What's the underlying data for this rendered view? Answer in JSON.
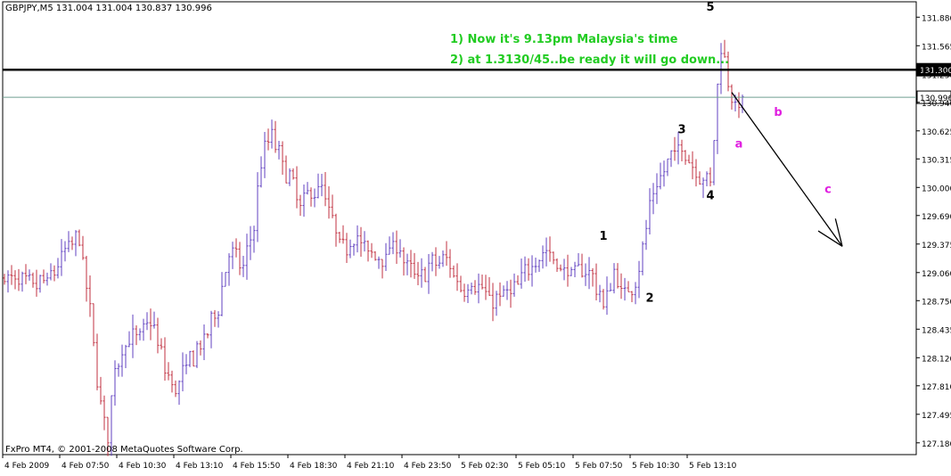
{
  "chart_data": {
    "type": "ohlc",
    "symbol_header": "GBPJPY,M5  131.004 131.004 130.837 130.996",
    "footer": "FxPro MT4, © 2001-2008 MetaQuotes Software Corp.",
    "y_axis": {
      "ylim": [
        127.05,
        132.05
      ],
      "ticks": [
        "131.880",
        "131.565",
        "131.250",
        "130.940",
        "130.625",
        "130.315",
        "130.000",
        "129.690",
        "129.375",
        "129.060",
        "128.750",
        "128.435",
        "128.120",
        "127.810",
        "127.495",
        "127.180"
      ]
    },
    "x_axis": {
      "tick_labels": [
        "4 Feb 2009",
        "4 Feb 07:50",
        "4 Feb 10:30",
        "4 Feb 13:10",
        "4 Feb 15:50",
        "4 Feb 18:30",
        "4 Feb 21:10",
        "4 Feb 23:50",
        "5 Feb 02:30",
        "5 Feb 05:10",
        "5 Feb 07:50",
        "5 Feb 10:30",
        "5 Feb 13:10"
      ]
    },
    "levels": [
      {
        "label": "131.300",
        "value": 131.3,
        "color": "#000000",
        "style": "thick"
      },
      {
        "label": "130.996",
        "value": 130.996,
        "color": "#6f9f90",
        "style": "thin"
      }
    ],
    "annotations": [
      {
        "text": "1) Now it's 9.13pm Malaysia's time",
        "color": "#22cc22"
      },
      {
        "text": "2) at 1.3130/45..be ready it will go down...",
        "color": "#22cc22"
      }
    ],
    "wave_labels": [
      {
        "text": "1",
        "color": "#000000",
        "bar": 168,
        "price": 129.42
      },
      {
        "text": "2",
        "color": "#000000",
        "bar": 181,
        "price": 128.74
      },
      {
        "text": "3",
        "color": "#000000",
        "bar": 190,
        "price": 130.6
      },
      {
        "text": "4",
        "color": "#000000",
        "bar": 198,
        "price": 129.87
      },
      {
        "text": "5",
        "color": "#000000",
        "bar": 198,
        "price": 131.95
      },
      {
        "text": "a",
        "color": "#e020e0",
        "bar": 206,
        "price": 130.44
      },
      {
        "text": "b",
        "color": "#e020e0",
        "bar": 217,
        "price": 130.79
      },
      {
        "text": "c",
        "color": "#e020e0",
        "bar": 231,
        "price": 129.94
      }
    ],
    "projection_arrow": {
      "from": {
        "bar": 204,
        "price": 131.05
      },
      "to": {
        "bar": 235,
        "price": 129.35
      },
      "color": "#000000"
    },
    "price_path": [
      [
        0,
        129.0
      ],
      [
        8,
        128.9
      ],
      [
        13,
        129.0
      ],
      [
        17,
        129.3
      ],
      [
        21,
        129.45
      ],
      [
        24,
        128.6
      ],
      [
        27,
        127.6
      ],
      [
        29,
        127.25
      ],
      [
        31,
        128.0
      ],
      [
        34,
        128.3
      ],
      [
        38,
        128.35
      ],
      [
        41,
        128.55
      ],
      [
        45,
        128.0
      ],
      [
        48,
        127.75
      ],
      [
        52,
        128.1
      ],
      [
        56,
        128.3
      ],
      [
        60,
        128.7
      ],
      [
        63,
        129.3
      ],
      [
        67,
        129.1
      ],
      [
        70,
        129.6
      ],
      [
        72,
        130.3
      ],
      [
        75,
        130.6
      ],
      [
        77,
        130.35
      ],
      [
        80,
        130.1
      ],
      [
        83,
        129.8
      ],
      [
        86,
        129.95
      ],
      [
        89,
        130.0
      ],
      [
        92,
        129.6
      ],
      [
        95,
        129.3
      ],
      [
        98,
        129.5
      ],
      [
        101,
        129.3
      ],
      [
        104,
        129.25
      ],
      [
        107,
        129.25
      ],
      [
        110,
        129.4
      ],
      [
        113,
        129.1
      ],
      [
        116,
        129.0
      ],
      [
        120,
        129.15
      ],
      [
        124,
        129.2
      ],
      [
        128,
        128.9
      ],
      [
        132,
        128.95
      ],
      [
        136,
        128.75
      ],
      [
        140,
        128.8
      ],
      [
        144,
        128.9
      ],
      [
        148,
        129.2
      ],
      [
        152,
        129.3
      ],
      [
        156,
        129.1
      ],
      [
        160,
        129.05
      ],
      [
        164,
        129.1
      ],
      [
        168,
        128.7
      ],
      [
        171,
        129.05
      ],
      [
        174,
        128.8
      ],
      [
        177,
        129.0
      ],
      [
        179,
        129.3
      ],
      [
        181,
        129.8
      ],
      [
        184,
        130.1
      ],
      [
        187,
        130.35
      ],
      [
        190,
        130.45
      ],
      [
        193,
        130.25
      ],
      [
        196,
        130.1
      ],
      [
        198,
        130.05
      ],
      [
        200,
        131.1
      ],
      [
        201,
        131.6
      ],
      [
        203,
        131.2
      ],
      [
        205,
        130.9
      ],
      [
        207,
        130.9
      ]
    ]
  }
}
